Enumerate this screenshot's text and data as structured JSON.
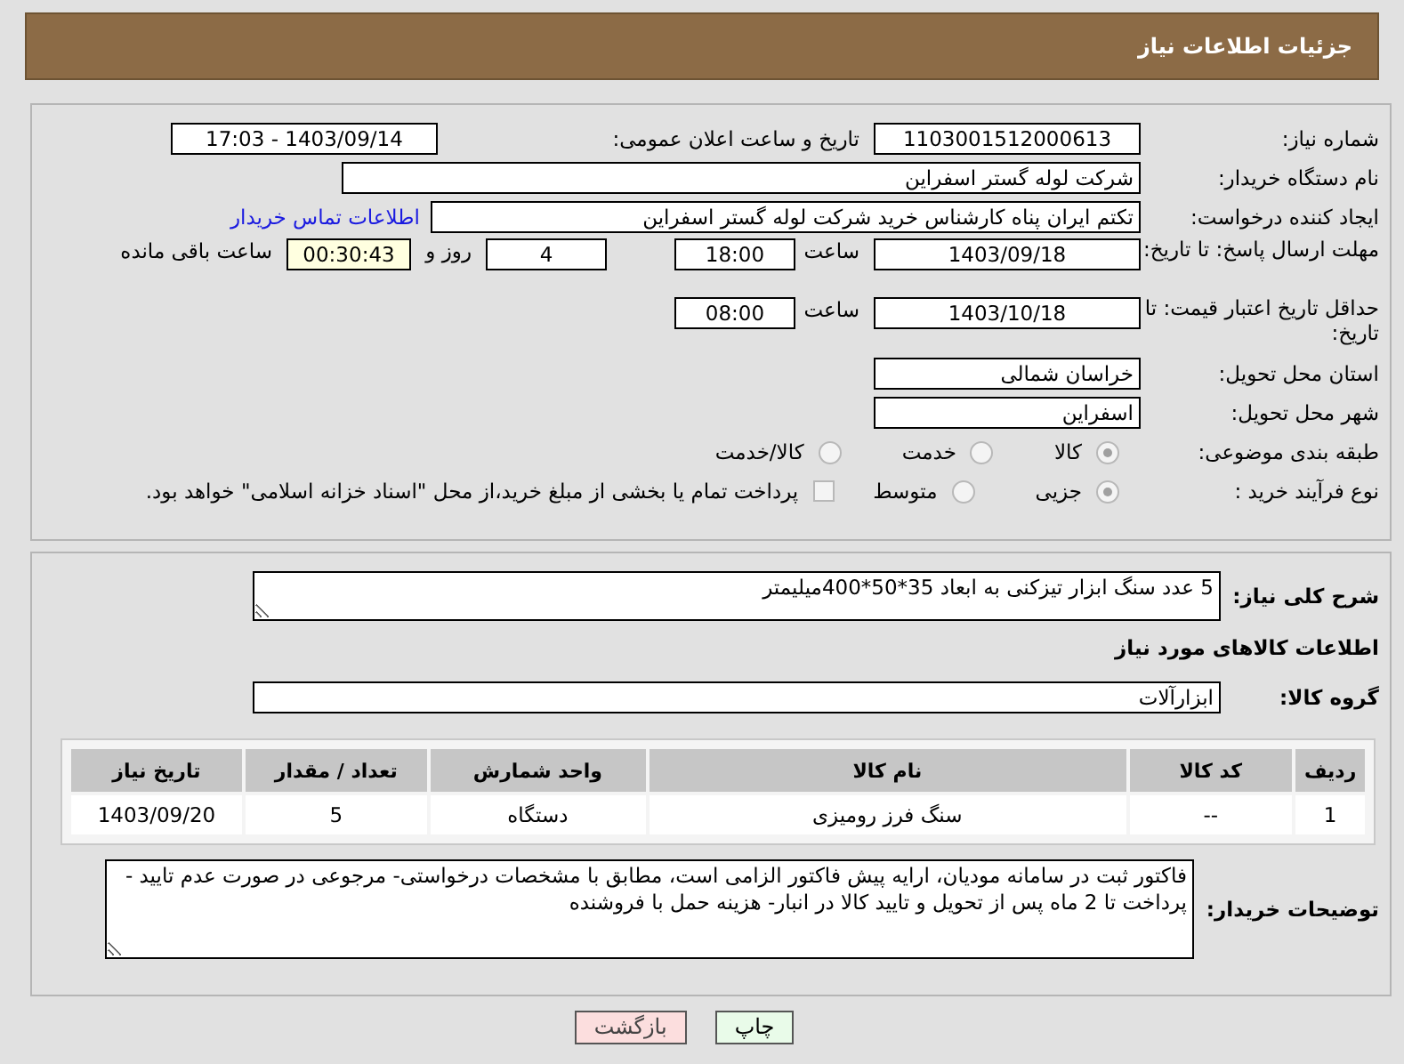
{
  "header": {
    "title": "جزئیات اطلاعات نیاز"
  },
  "request": {
    "need_number": {
      "label": "شماره نیاز:",
      "value": "1103001512000613"
    },
    "announce": {
      "label": "تاریخ و ساعت اعلان عمومی:",
      "value": "1403/09/14 - 17:03"
    },
    "buyer": {
      "label": "نام دستگاه خریدار:",
      "value": "شرکت لوله گستر اسفراین"
    },
    "creator": {
      "label": "ایجاد کننده درخواست:",
      "value": "تکتم ایران پناه کارشناس خرید شرکت لوله گستر اسفراین",
      "link": "اطلاعات تماس خریدار"
    },
    "deadline": {
      "label": "مهلت ارسال پاسخ: تا تاریخ:",
      "date": "1403/09/18",
      "time_label": "ساعت",
      "time": "18:00",
      "days": "4",
      "days_label": "روز و",
      "remaining": "00:30:43",
      "remaining_label": "ساعت باقی مانده"
    },
    "validity": {
      "label": "حداقل تاریخ اعتبار قیمت: تا تاریخ:",
      "date": "1403/10/18",
      "time_label": "ساعت",
      "time": "08:00"
    },
    "province": {
      "label": "استان محل تحویل:",
      "value": "خراسان شمالی"
    },
    "city": {
      "label": "شهر محل تحویل:",
      "value": "اسفراین"
    },
    "category": {
      "label": "طبقه بندی موضوعی:",
      "options": [
        {
          "label": "کالا",
          "selected": true
        },
        {
          "label": "خدمت",
          "selected": false
        },
        {
          "label": "کالا/خدمت",
          "selected": false
        }
      ]
    },
    "process": {
      "label": "نوع فرآیند خرید :",
      "options": [
        {
          "label": "جزیی",
          "selected": true
        },
        {
          "label": "متوسط",
          "selected": false
        }
      ],
      "treasury": {
        "label": "پرداخت تمام یا بخشی از مبلغ خرید،از محل \"اسناد خزانه اسلامی\" خواهد بود.",
        "checked": false
      }
    }
  },
  "details": {
    "summary": {
      "label": "شرح کلی نیاز:",
      "value": "5 عدد سنگ ابزار تیزکنی به ابعاد 35*50*400میلیمتر"
    },
    "goods_heading": "اطلاعات کالاهای مورد نیاز",
    "group": {
      "label": "گروه کالا:",
      "value": "ابزارآلات"
    },
    "table": {
      "columns": [
        "ردیف",
        "کد کالا",
        "نام کالا",
        "واحد شمارش",
        "تعداد / مقدار",
        "تاریخ نیاز"
      ],
      "rows": [
        [
          "1",
          "--",
          "سنگ فرز رومیزی",
          "دستگاه",
          "5",
          "1403/09/20"
        ]
      ]
    },
    "notes": {
      "label": "توضیحات خریدار:",
      "value": "فاکتور ثبت در سامانه مودیان، ارایه پیش فاکتور الزامی است، مطابق با مشخصات درخواستی- مرجوعی در صورت عدم تایید - پرداخت تا 2 ماه پس از تحویل و تایید کالا در انبار- هزینه حمل با فروشنده"
    }
  },
  "buttons": [
    {
      "label": "چاپ",
      "kind": "print"
    },
    {
      "label": "بازگشت",
      "kind": "back"
    }
  ]
}
